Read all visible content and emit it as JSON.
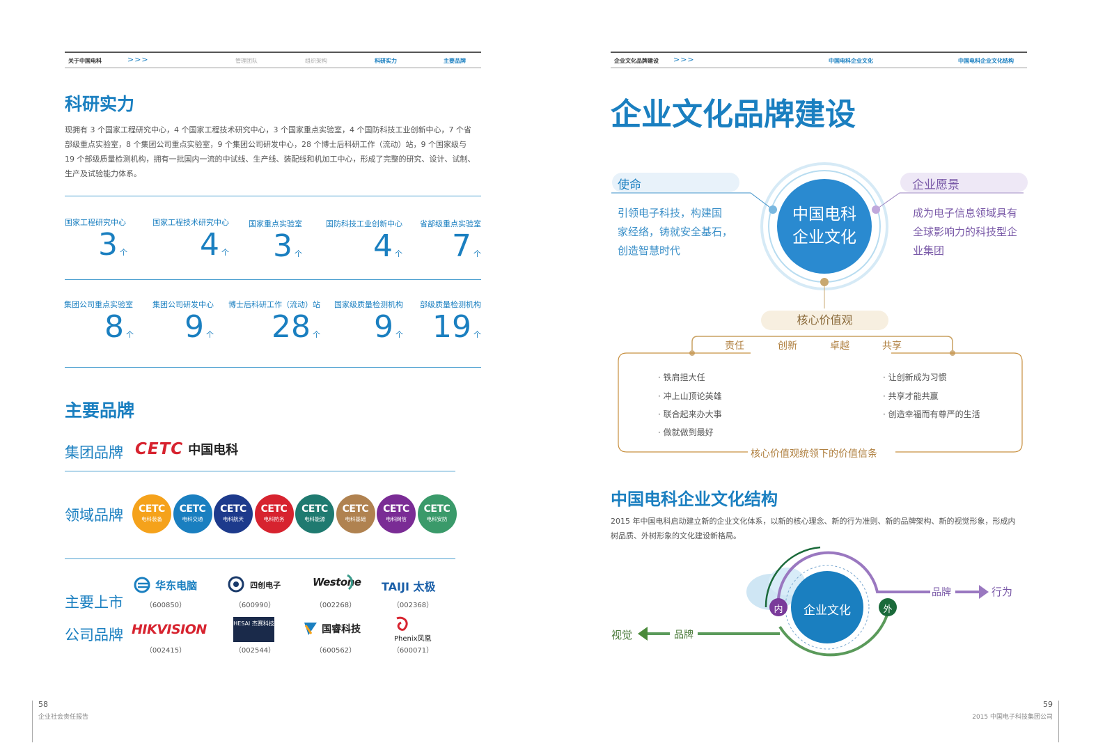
{
  "left_page": {
    "nav": {
      "section": "关于中国电科",
      "arrows": ">>>",
      "items": [
        "管理团队",
        "组织架构",
        "科研实力",
        "主要品牌"
      ]
    },
    "research": {
      "title": "科研实力",
      "paragraph": [
        "现拥有 3 个国家工程研究中心，4 个国家工程技术研究中心，3 个国家重点实验室，4 个国防科技工业创新中心，7 个省",
        "部级重点实验室，8 个集团公司重点实验室，9 个集团公司研发中心，28 个博士后科研工作（流动）站，9 个国家级与",
        "19 个部级质量检测机构，拥有一批国内一流的中试线、生产线、装配线和机加工中心，形成了完整的研究、设计、试制、",
        "生产及试验能力体系。"
      ],
      "unit": "个",
      "row1": [
        {
          "label": "国家工程研究中心",
          "value": "3"
        },
        {
          "label": "国家工程技术研究中心",
          "value": "4"
        },
        {
          "label": "国家重点实验室",
          "value": "3"
        },
        {
          "label": "国防科技工业创新中心",
          "value": "4"
        },
        {
          "label": "省部级重点实验室",
          "value": "7"
        }
      ],
      "row2": [
        {
          "label": "集团公司重点实验室",
          "value": "8"
        },
        {
          "label": "集团公司研发中心",
          "value": "9"
        },
        {
          "label": "博士后科研工作（流动）站",
          "value": "28"
        },
        {
          "label": "国家级质量检测机构",
          "value": "9"
        },
        {
          "label": "部级质量检测机构",
          "value": "19"
        }
      ]
    },
    "brands": {
      "title": "主要品牌",
      "group_label": "集团品牌",
      "group_logo_en": "CETC",
      "group_logo_cn": "中国电科",
      "domain_label": "领域品牌",
      "domain_items": [
        {
          "name": "电科装备",
          "color": "#f5a21b"
        },
        {
          "name": "电科交通",
          "color": "#1a7fc0"
        },
        {
          "name": "电科航天",
          "color": "#1d3a8c"
        },
        {
          "name": "电科防务",
          "color": "#d7232f"
        },
        {
          "name": "电科能源",
          "color": "#1f7a70"
        },
        {
          "name": "电科基础",
          "color": "#b08250"
        },
        {
          "name": "电科网信",
          "color": "#7a2c95"
        },
        {
          "name": "电科安防",
          "color": "#3a9a6a"
        }
      ],
      "domain_logo_text": "CETC",
      "listed_label_1": "主要上市",
      "listed_label_2": "公司品牌",
      "listed": [
        {
          "name": "华东电脑",
          "code": "（600850）"
        },
        {
          "name": "四创电子",
          "code": "（600990）"
        },
        {
          "name": "Westone",
          "code": "（002268）"
        },
        {
          "name": "TAIJI 太极",
          "code": "（002368）"
        },
        {
          "name": "HIKVISION",
          "code": "（002415）"
        },
        {
          "name": "HESAI 杰赛科技",
          "code": "（002544）"
        },
        {
          "name": "国睿科技",
          "code": "（600562）"
        },
        {
          "name": "Phenix凤凰",
          "code": "（600071）"
        }
      ]
    },
    "footer": {
      "page": "58",
      "text": "企业社会责任报告"
    }
  },
  "right_page": {
    "nav": {
      "section": "企业文化品牌建设",
      "arrows": ">>>",
      "items": [
        "中国电科企业文化",
        "中国电科企业文化结构"
      ]
    },
    "title": "企业文化品牌建设",
    "mission": {
      "label": "使命",
      "lines": [
        "引领电子科技，构建国",
        "家经络，铸就安全基石，",
        "创造智慧时代"
      ]
    },
    "vision": {
      "label": "企业愿景",
      "lines": [
        "成为电子信息领域具有",
        "全球影响力的科技型企",
        "业集团"
      ]
    },
    "center": {
      "line1": "中国电科",
      "line2": "企业文化"
    },
    "core_values": {
      "label": "核心价值观",
      "items": [
        "责任",
        "创新",
        "卓越",
        "共享"
      ],
      "beliefs_left": [
        "· 铁肩担大任",
        "· 冲上山顶论英雄",
        "· 联合起来办大事",
        "· 做就做到最好"
      ],
      "beliefs_right": [
        "· 让创新成为习惯",
        "· 共享才能共赢",
        "· 创造幸福而有尊严的生活"
      ],
      "caption": "核心价值观统领下的价值信条"
    },
    "structure": {
      "title": "中国电科企业文化结构",
      "paragraph": [
        "2015 年中国电科启动建立新的企业文化体系，以新的核心理念、新的行为准则、新的品牌架构、新的视觉形象，形成内",
        "树品质、外树形象的文化建设新格局。"
      ],
      "center": "企业文化",
      "inner": "内",
      "outer": "外",
      "brand_right": "品牌",
      "behavior": "行为",
      "brand_left": "品牌",
      "visual": "视觉"
    },
    "footer": {
      "page": "59",
      "text": "2015 中国电子科技集团公司"
    }
  }
}
